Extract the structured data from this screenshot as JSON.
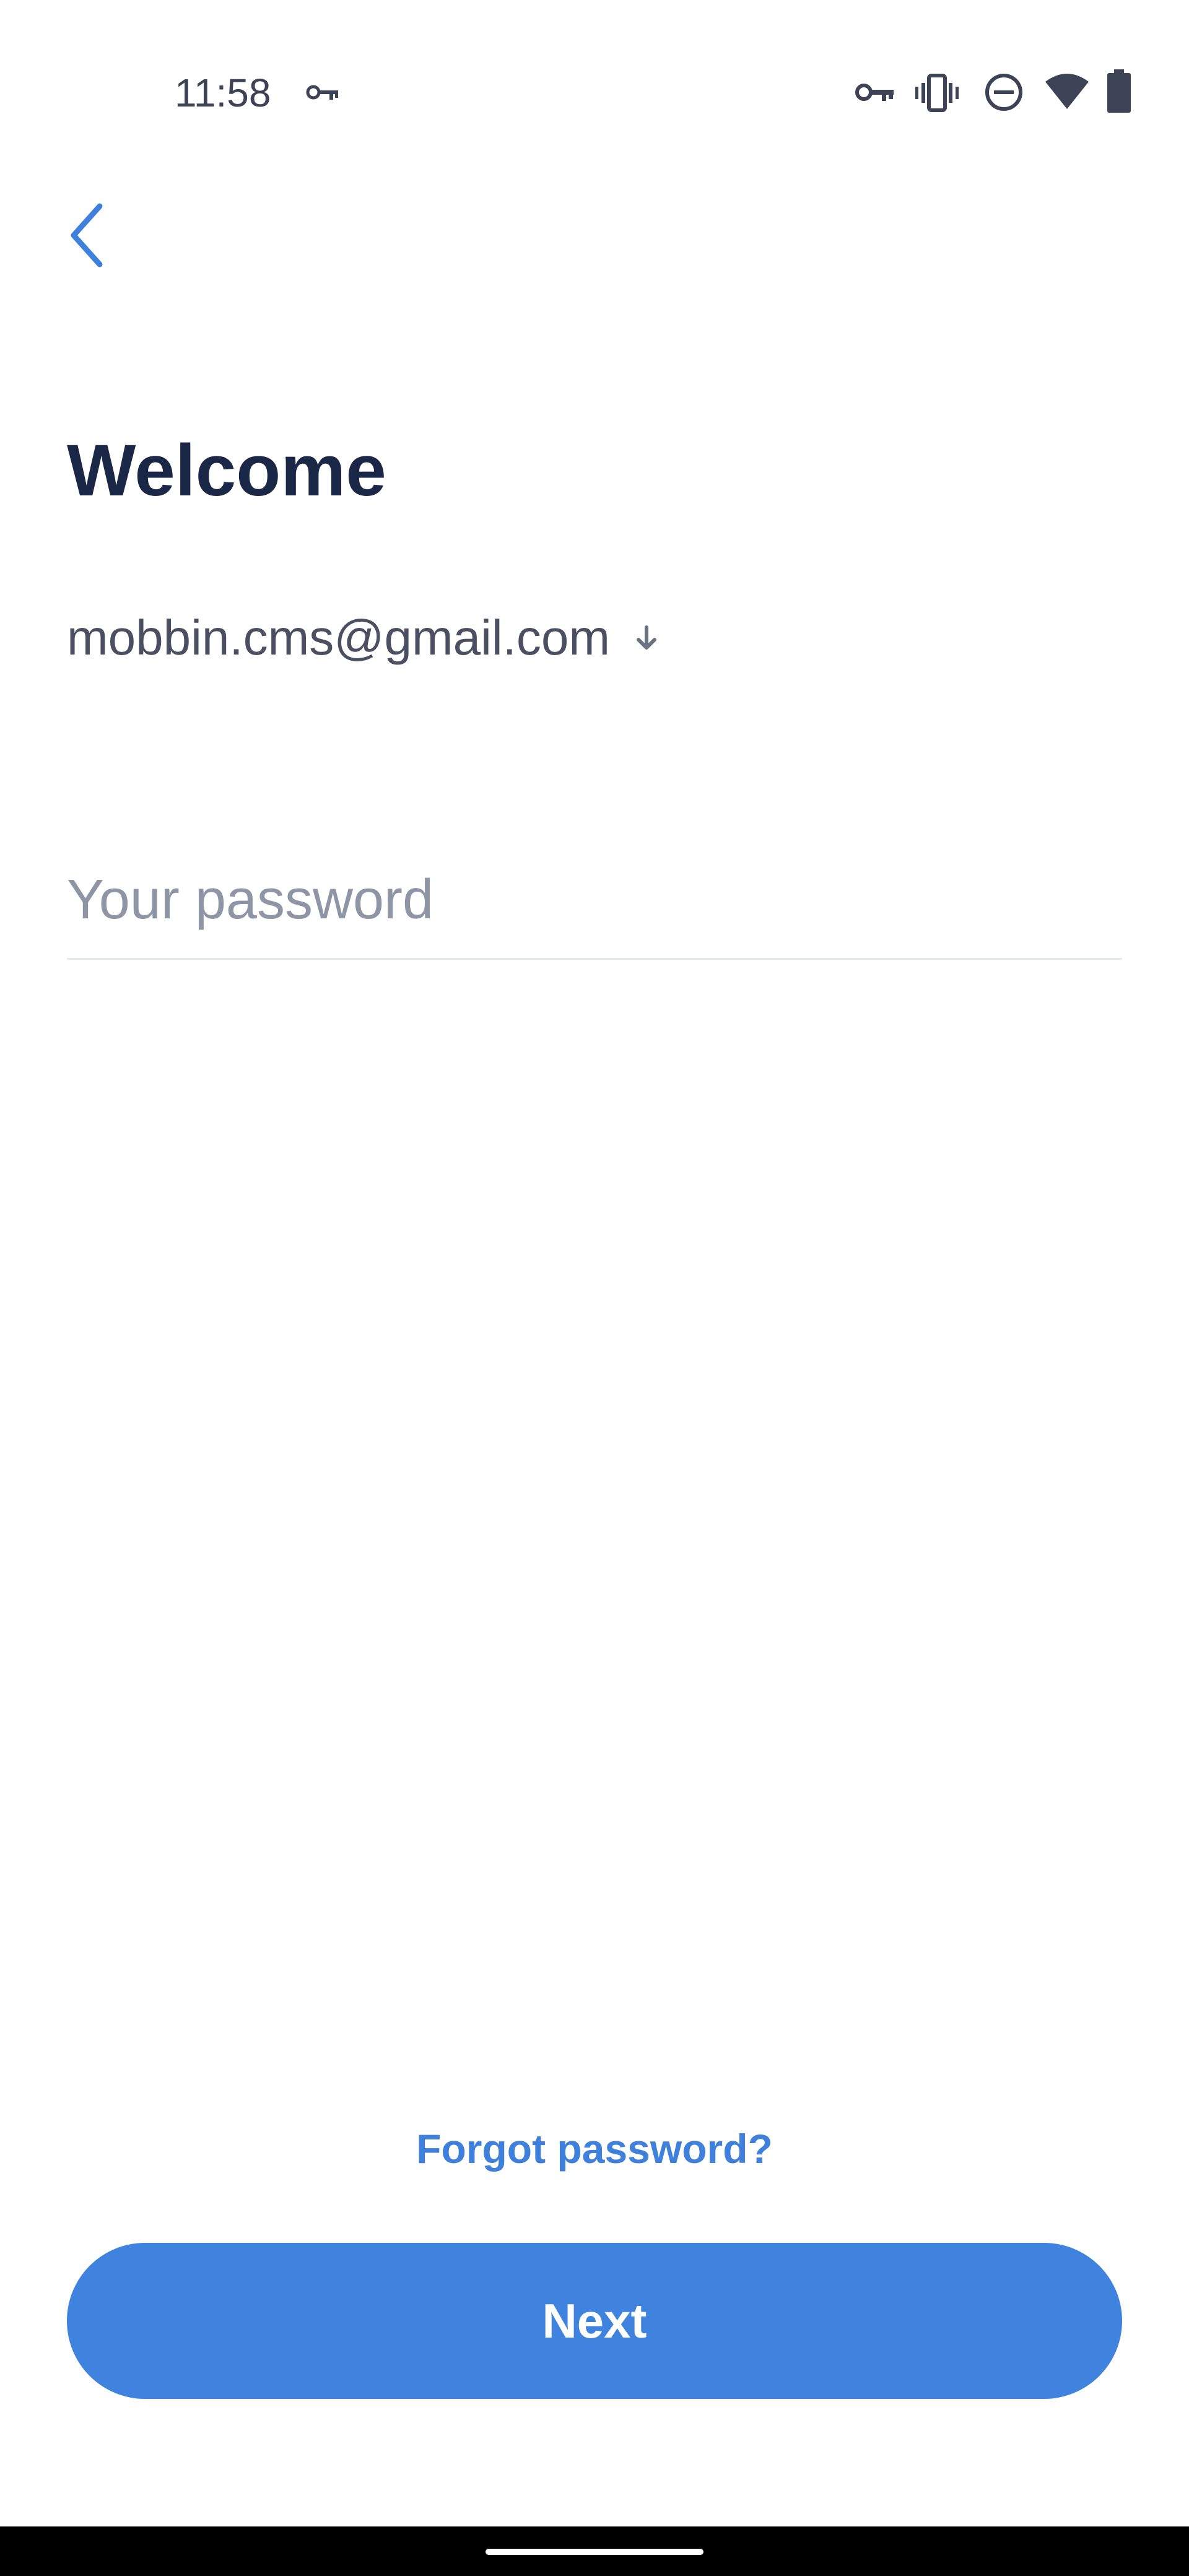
{
  "status_bar": {
    "time": "11:58",
    "left_icons": [
      "vpn-key-icon"
    ],
    "right_icons": [
      "vpn-key-icon",
      "vibrate-icon",
      "do-not-disturb-icon",
      "wifi-icon",
      "battery-icon"
    ]
  },
  "header": {
    "back_icon": "chevron-left-icon"
  },
  "main": {
    "title": "Welcome",
    "account_email": "mobbin.cms@gmail.com",
    "account_dropdown_icon": "arrow-down-icon",
    "password": {
      "value": "",
      "placeholder": "Your password"
    },
    "forgot_password_label": "Forgot password?",
    "next_label": "Next"
  },
  "colors": {
    "accent": "#4083df",
    "title": "#1b2747",
    "body_text": "#4a5061",
    "placeholder": "#8e96a6",
    "divider": "#e6e9ee",
    "status_icons": "#3c4354"
  }
}
